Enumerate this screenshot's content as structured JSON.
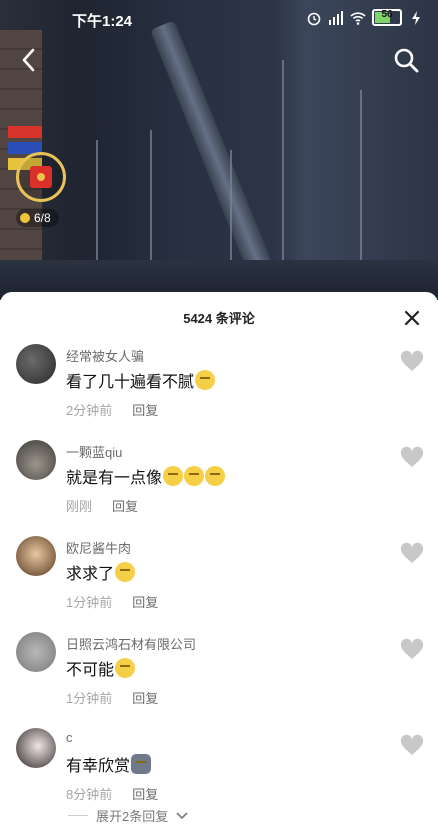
{
  "status_bar": {
    "time": "下午1:24",
    "battery": "56"
  },
  "widget": {
    "coin_count": "6/8"
  },
  "comments_header": {
    "count_label": "5424 条评论"
  },
  "comments": [
    {
      "username": "经常被女人骗",
      "text": "看了几十遍看不腻",
      "emojis": 1,
      "time": "2分钟前",
      "reply": "回复"
    },
    {
      "username": "一颗蓝qiu",
      "text": "就是有一点像",
      "emojis": 3,
      "time": "刚刚",
      "reply": "回复"
    },
    {
      "username": "欧尼酱牛肉",
      "text": "求求了",
      "emojis": 1,
      "time": "1分钟前",
      "reply": "回复"
    },
    {
      "username": "日照云鸿石材有限公司",
      "text": "不可能",
      "emojis": 1,
      "time": "1分钟前",
      "reply": "回复"
    },
    {
      "username": "c",
      "text": "有幸欣赏",
      "emojis": 1,
      "time": "8分钟前",
      "reply": "回复"
    }
  ],
  "expand_replies": "展开2条回复",
  "icons": {
    "back": "back-arrow-icon",
    "search": "search-icon",
    "close": "close-icon",
    "like": "heart-icon",
    "chevron": "chevron-down-icon"
  },
  "colors": {
    "heart": "#c8c8c8",
    "meta_text": "#a5a5a5"
  }
}
